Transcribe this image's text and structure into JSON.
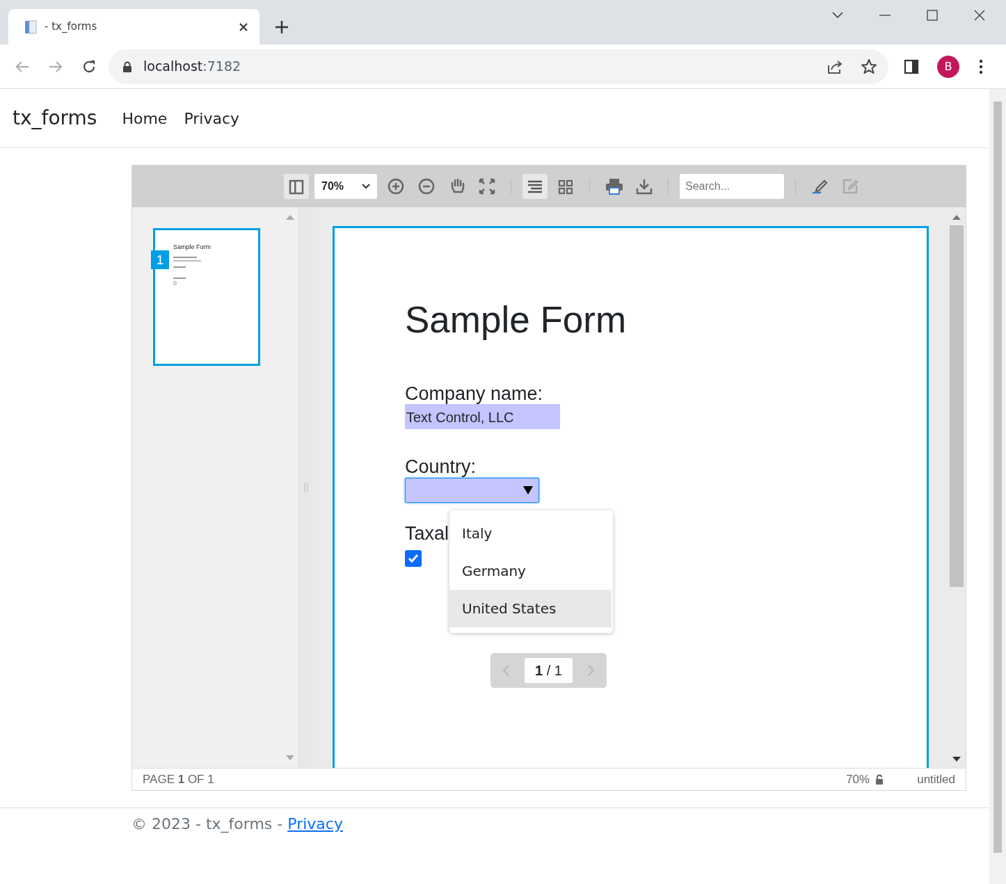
{
  "browser": {
    "tab_title": "- tx_forms",
    "url_host": "localhost",
    "url_port": ":7182",
    "profile": "B"
  },
  "navbar": {
    "brand": "tx_forms",
    "links": [
      {
        "label": "Home"
      },
      {
        "label": "Privacy"
      }
    ]
  },
  "viewer": {
    "toolbar": {
      "sidebar_open": true,
      "zoom": "70%",
      "layouts": [
        {
          "kind": "single",
          "selected": true
        },
        {
          "kind": "grid",
          "selected": false
        }
      ],
      "search_placeholder": "Search...",
      "edit_disabled": true
    },
    "thumbnails": [
      {
        "number": "1",
        "selected": true,
        "title": "Sample Form"
      }
    ],
    "document": {
      "title": "Sample Form",
      "fields": [
        {
          "kind": "text",
          "label": "Company name:",
          "value": "Text Control, LLC"
        },
        {
          "kind": "dropdown",
          "label": "Country:",
          "open": true,
          "options": [
            {
              "label": "Italy",
              "selected": false
            },
            {
              "label": "Germany",
              "selected": false
            },
            {
              "label": "United States",
              "selected": true
            }
          ]
        },
        {
          "kind": "checkbox",
          "label": "Taxal",
          "checked": true
        }
      ]
    },
    "pager": "**1** / 1",
    "status_bar": {
      "page": "PAGE **1** OF 1",
      "zoom": "70%",
      "filename": "untitled"
    }
  },
  "footer": {
    "text": "© 2023 - tx_forms -",
    "link": "Privacy"
  }
}
